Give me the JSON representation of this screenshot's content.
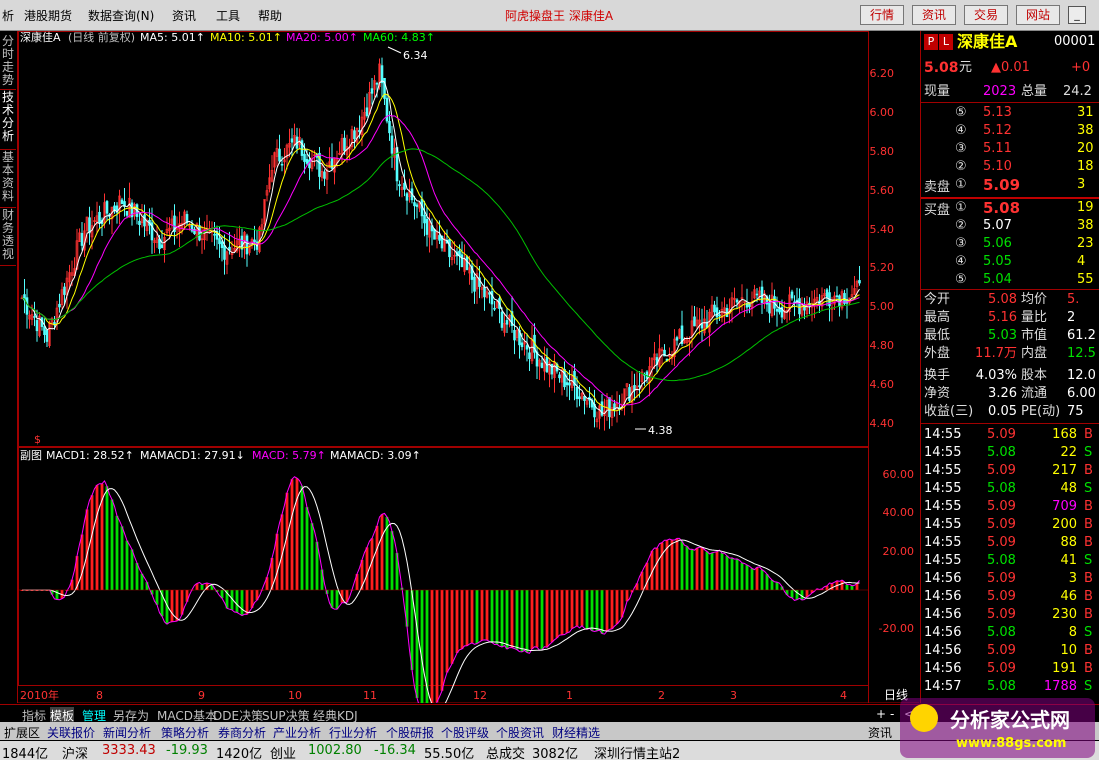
{
  "menubar": {
    "items": [
      "析",
      "港股期货",
      "数据查询(N)",
      "资讯",
      "工具",
      "帮助"
    ],
    "app_title": "阿虎操盘王  深康佳A",
    "buttons": [
      "行情",
      "资讯",
      "交易",
      "网站"
    ],
    "window_controls": [
      "minimize-icon",
      "restore-icon",
      "close-icon"
    ]
  },
  "left_tabs": [
    "分时走势",
    "技术分析",
    "基本资料",
    "财务透视"
  ],
  "chart": {
    "header": {
      "name": "深康佳A",
      "period": "(日线 前复权)",
      "ma5": "MA5: 5.01↑",
      "ma10": "MA10: 5.01↑",
      "ma20": "MA20: 5.00↑",
      "ma60": "MA60: 4.83↑"
    },
    "sub_header": {
      "name": "副图",
      "macd1": "MACD1: 28.52↑",
      "mamacd1": "MAMACD1: 27.91↓",
      "macd": "MACD: 5.79↑",
      "mamacd": "MAMACD: 3.09↑"
    },
    "price_labels": [
      "6.20",
      "6.00",
      "5.80",
      "5.60",
      "5.40",
      "5.20",
      "5.00",
      "4.80",
      "4.60",
      "4.40"
    ],
    "macd_labels": [
      "60.00",
      "40.00",
      "20.00",
      "0.00",
      "-20.00"
    ],
    "high_label": "6.34",
    "low_label": "4.38",
    "signal_mark": "$",
    "x_labels": [
      "2010年",
      "8",
      "9",
      "10",
      "11",
      "12",
      "1",
      "2",
      "3",
      "4"
    ],
    "period_label": "日线",
    "colors": {
      "up": "#ff3232",
      "down": "#54ffff",
      "ma5": "#ffffff",
      "ma10": "#ffff00",
      "ma20": "#ff00ff",
      "ma60": "#00c000",
      "macd_up": "#ff1e1e",
      "macd_down": "#00e000"
    }
  },
  "quote": {
    "pl": [
      "P",
      "L"
    ],
    "name": "深康佳A",
    "code": "00001",
    "price": "5.08",
    "price_unit": "元",
    "change": "▲0.01",
    "change_pct": "+0",
    "volume_now_label": "现量",
    "volume_now": "2023",
    "volume_total_label": "总量",
    "volume_total": "24.2",
    "sell_label": "卖盘",
    "buy_label": "买盘",
    "sells": [
      {
        "idx": "⑤",
        "price": "5.13",
        "vol": "31"
      },
      {
        "idx": "④",
        "price": "5.12",
        "vol": "38"
      },
      {
        "idx": "③",
        "price": "5.11",
        "vol": "20"
      },
      {
        "idx": "②",
        "price": "5.10",
        "vol": "18"
      },
      {
        "idx": "①",
        "price": "5.09",
        "vol": "3"
      }
    ],
    "buys": [
      {
        "idx": "①",
        "price": "5.08",
        "vol": "19"
      },
      {
        "idx": "②",
        "price": "5.07",
        "vol": "38"
      },
      {
        "idx": "③",
        "price": "5.06",
        "vol": "23"
      },
      {
        "idx": "④",
        "price": "5.05",
        "vol": "4"
      },
      {
        "idx": "⑤",
        "price": "5.04",
        "vol": "55"
      }
    ],
    "stats": [
      {
        "l1": "今开",
        "v1": "5.08",
        "l2": "均价",
        "v2": "5."
      },
      {
        "l1": "最高",
        "v1": "5.16",
        "l2": "量比",
        "v2": "2"
      },
      {
        "l1": "最低",
        "v1": "5.03",
        "l2": "市值",
        "v2": "61.2"
      },
      {
        "l1": "外盘",
        "v1": "11.7万",
        "l2": "内盘",
        "v2": "12.5"
      },
      {
        "l1": "换手",
        "v1": "4.03%",
        "l2": "股本",
        "v2": "12.0"
      },
      {
        "l1": "净资",
        "v1": "3.26",
        "l2": "流通",
        "v2": "6.00"
      },
      {
        "l1": "收益(三)",
        "v1": "0.05",
        "l2": "PE(动)",
        "v2": "75"
      }
    ],
    "ticks": [
      {
        "t": "14:55",
        "p": "5.09",
        "v": "168",
        "s": "B"
      },
      {
        "t": "14:55",
        "p": "5.08",
        "v": "22",
        "s": "S"
      },
      {
        "t": "14:55",
        "p": "5.09",
        "v": "217",
        "s": "B"
      },
      {
        "t": "14:55",
        "p": "5.08",
        "v": "48",
        "s": "S"
      },
      {
        "t": "14:55",
        "p": "5.09",
        "v": "709",
        "s": "B"
      },
      {
        "t": "14:55",
        "p": "5.09",
        "v": "200",
        "s": "B"
      },
      {
        "t": "14:55",
        "p": "5.09",
        "v": "88",
        "s": "B"
      },
      {
        "t": "14:55",
        "p": "5.08",
        "v": "41",
        "s": "S"
      },
      {
        "t": "14:56",
        "p": "5.09",
        "v": "3",
        "s": "B"
      },
      {
        "t": "14:56",
        "p": "5.09",
        "v": "46",
        "s": "B"
      },
      {
        "t": "14:56",
        "p": "5.09",
        "v": "230",
        "s": "B"
      },
      {
        "t": "14:56",
        "p": "5.08",
        "v": "8",
        "s": "S"
      },
      {
        "t": "14:56",
        "p": "5.09",
        "v": "10",
        "s": "B"
      },
      {
        "t": "14:56",
        "p": "5.09",
        "v": "191",
        "s": "B"
      },
      {
        "t": "14:57",
        "p": "5.08",
        "v": "1788",
        "s": "S"
      }
    ]
  },
  "tabs_row1": [
    "指标",
    "模板",
    "管理",
    "另存为",
    "MACD基本",
    "DDE决策",
    "SUP决策",
    "经典KDJ"
  ],
  "tabs_row1_controls": [
    "+",
    "-",
    "<",
    ">"
  ],
  "tabs_row2": [
    "扩展区",
    "关联报价",
    "新闻分析",
    "策略分析",
    "券商分析",
    "产业分析",
    "行业分析",
    "个股研报",
    "个股评级",
    "个股资讯",
    "财经精选"
  ],
  "tabs_row2_right": "资讯",
  "status": {
    "s1": "1844亿",
    "s2": "沪深",
    "s3": "3333.43",
    "s4": "-19.93",
    "s5": "1420亿",
    "s6": "创业",
    "s7": "1002.80",
    "s8": "-16.34",
    "s9": "55.50亿",
    "s10": "总成交",
    "s11": "3082亿",
    "s12": "深圳行情主站2"
  },
  "logo": {
    "text": "分析家公式网",
    "url": "www.88gs.com"
  }
}
